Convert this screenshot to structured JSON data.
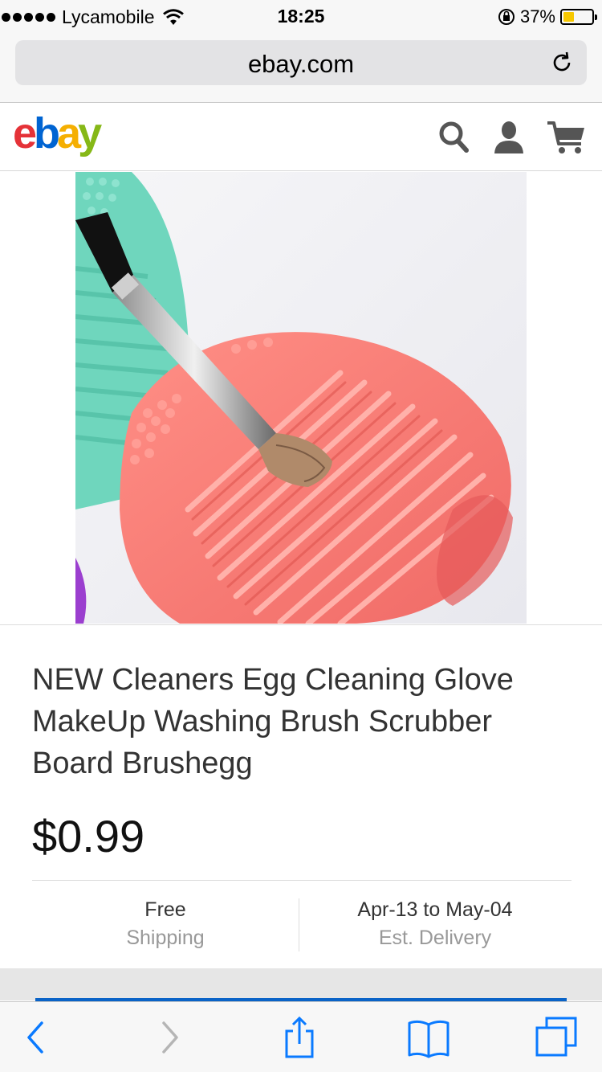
{
  "status_bar": {
    "carrier": "Lycamobile",
    "time": "18:25",
    "battery_percent": "37%",
    "battery_level": 0.37
  },
  "browser": {
    "url": "ebay.com"
  },
  "header": {
    "logo": {
      "e": "e",
      "b": "b",
      "a": "a",
      "y": "y"
    },
    "brand_colors": {
      "e": "#e53238",
      "b": "#0064d2",
      "a": "#f5af02",
      "y": "#86b817"
    },
    "icons": [
      "search-icon",
      "user-icon",
      "cart-icon"
    ]
  },
  "product": {
    "title": "NEW Cleaners Egg Cleaning Glove MakeUp Washing Brush Scrubber Board Brushegg",
    "price": "$0.99",
    "shipping": {
      "main": "Free",
      "sub": "Shipping"
    },
    "delivery": {
      "main": "Apr-13 to May-04",
      "sub": "Est. Delivery"
    }
  },
  "toolbar": {
    "icons": [
      "back-icon",
      "forward-icon",
      "share-icon",
      "bookmarks-icon",
      "tabs-icon"
    ],
    "accent": "#0a7aff"
  }
}
